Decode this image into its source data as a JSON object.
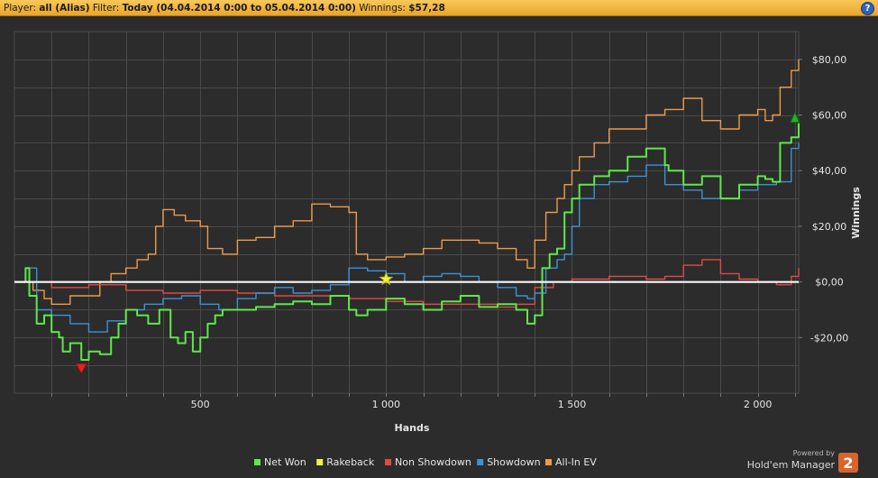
{
  "header": {
    "player_label": "Player:",
    "player_value": "all (Alias)",
    "filter_label": "Filter:",
    "filter_value": "Today (04.04.2014 0:00 to 05.04.2014 0:00)",
    "winnings_label": "Winnings:",
    "winnings_value": "$57,28",
    "help_icon": "?"
  },
  "brand": {
    "powered_by": "Powered by",
    "name": "Hold'em Manager",
    "badge": "2"
  },
  "colors": {
    "background": "#2c2c2c",
    "grid": "#4a4a4a",
    "text": "#e6e6e6",
    "net_won": "#5ee84a",
    "rakeback": "#f2f244",
    "non_showdown": "#e04a44",
    "showdown": "#3a92d8",
    "all_in_ev": "#ee9a48",
    "zero_line": "#ffffff"
  },
  "chart_data": {
    "type": "line",
    "xlabel": "Hands",
    "ylabel": "Winnings",
    "xlim": [
      0,
      2110
    ],
    "ylim": [
      -40,
      90
    ],
    "x_ticks": [
      500,
      1000,
      1500,
      2000
    ],
    "x_tick_labels": [
      "500",
      "1 000",
      "1 500",
      "2 000"
    ],
    "y_ticks": [
      -20,
      0,
      20,
      40,
      60,
      80
    ],
    "y_tick_labels": [
      "-$20,00",
      "$0,00",
      "$20,00",
      "$40,00",
      "$60,00",
      "$80,00"
    ],
    "grid": true,
    "legend_position": "bottom",
    "series": [
      {
        "name": "Net Won",
        "color": "#5ee84a",
        "x": [
          0,
          30,
          40,
          60,
          80,
          100,
          120,
          130,
          150,
          180,
          200,
          230,
          260,
          280,
          300,
          330,
          360,
          390,
          420,
          440,
          460,
          480,
          500,
          520,
          540,
          560,
          600,
          650,
          700,
          750,
          800,
          850,
          900,
          920,
          950,
          1000,
          1050,
          1100,
          1150,
          1200,
          1250,
          1300,
          1350,
          1380,
          1400,
          1420,
          1440,
          1460,
          1480,
          1500,
          1520,
          1560,
          1600,
          1650,
          1700,
          1750,
          1760,
          1800,
          1850,
          1900,
          1950,
          2000,
          2020,
          2040,
          2060,
          2090,
          2110
        ],
        "y": [
          0,
          5,
          -5,
          -15,
          -12,
          -18,
          -20,
          -25,
          -22,
          -28,
          -25,
          -26,
          -20,
          -15,
          -10,
          -12,
          -15,
          -10,
          -20,
          -22,
          -18,
          -25,
          -20,
          -15,
          -12,
          -10,
          -10,
          -9,
          -8,
          -7,
          -8,
          -5,
          -10,
          -12,
          -10,
          -6,
          -8,
          -10,
          -7,
          -5,
          -9,
          -8,
          -10,
          -15,
          -12,
          5,
          10,
          12,
          25,
          30,
          35,
          38,
          40,
          45,
          48,
          42,
          40,
          35,
          38,
          30,
          35,
          38,
          37,
          36,
          50,
          52,
          57
        ]
      },
      {
        "name": "Rakeback",
        "color": "#f2f244",
        "x": [
          0,
          2110
        ],
        "y": [
          0,
          0
        ]
      },
      {
        "name": "Non Showdown",
        "color": "#e04a44",
        "x": [
          0,
          100,
          200,
          300,
          400,
          500,
          600,
          700,
          800,
          900,
          1000,
          1100,
          1200,
          1300,
          1350,
          1400,
          1450,
          1500,
          1600,
          1700,
          1750,
          1800,
          1850,
          1900,
          1950,
          2000,
          2050,
          2090,
          2110
        ],
        "y": [
          0,
          -2,
          -1,
          -3,
          -4,
          -3,
          -4,
          -5,
          -5,
          -6,
          -7,
          -8,
          -8,
          -9,
          -8,
          -2,
          0,
          1,
          2,
          1,
          2,
          6,
          8,
          3,
          1,
          0,
          -1,
          2,
          5
        ]
      },
      {
        "name": "Showdown",
        "color": "#3a92d8",
        "x": [
          0,
          30,
          60,
          100,
          150,
          200,
          250,
          300,
          350,
          400,
          450,
          500,
          550,
          600,
          650,
          700,
          750,
          800,
          850,
          900,
          950,
          1000,
          1050,
          1100,
          1150,
          1200,
          1250,
          1300,
          1350,
          1380,
          1400,
          1430,
          1460,
          1480,
          1500,
          1520,
          1560,
          1600,
          1650,
          1700,
          1750,
          1800,
          1850,
          1900,
          1950,
          2000,
          2050,
          2090,
          2110
        ],
        "y": [
          0,
          5,
          -10,
          -12,
          -15,
          -18,
          -14,
          -10,
          -8,
          -6,
          -5,
          -8,
          -10,
          -6,
          -4,
          -2,
          -4,
          -3,
          -1,
          5,
          4,
          3,
          0,
          2,
          3,
          2,
          0,
          -2,
          -5,
          -6,
          -4,
          5,
          8,
          10,
          20,
          30,
          35,
          36,
          38,
          42,
          35,
          33,
          30,
          30,
          33,
          35,
          36,
          48,
          50
        ]
      },
      {
        "name": "All-In EV",
        "color": "#ee9a48",
        "x": [
          0,
          50,
          80,
          100,
          150,
          200,
          230,
          260,
          300,
          330,
          360,
          380,
          400,
          430,
          460,
          500,
          520,
          560,
          600,
          650,
          700,
          750,
          800,
          850,
          900,
          920,
          950,
          1000,
          1050,
          1100,
          1150,
          1200,
          1250,
          1300,
          1350,
          1380,
          1400,
          1430,
          1460,
          1480,
          1500,
          1520,
          1560,
          1600,
          1650,
          1700,
          1750,
          1800,
          1850,
          1900,
          1950,
          2000,
          2020,
          2040,
          2060,
          2090,
          2110
        ],
        "y": [
          0,
          -3,
          -6,
          -8,
          -5,
          -5,
          0,
          3,
          5,
          8,
          10,
          20,
          26,
          24,
          22,
          20,
          12,
          10,
          15,
          16,
          20,
          22,
          28,
          27,
          25,
          10,
          8,
          9,
          10,
          12,
          15,
          15,
          14,
          12,
          8,
          5,
          15,
          25,
          30,
          35,
          40,
          45,
          50,
          55,
          55,
          60,
          62,
          66,
          58,
          55,
          60,
          62,
          58,
          60,
          70,
          76,
          80
        ]
      }
    ],
    "markers": [
      {
        "shape": "triangle-down",
        "color": "#e02424",
        "x": 180,
        "y": -31
      },
      {
        "shape": "star",
        "color": "#f2f244",
        "x": 1000,
        "y": 1
      },
      {
        "shape": "triangle-up",
        "color": "#1fb51f",
        "x": 2100,
        "y": 59
      }
    ]
  }
}
